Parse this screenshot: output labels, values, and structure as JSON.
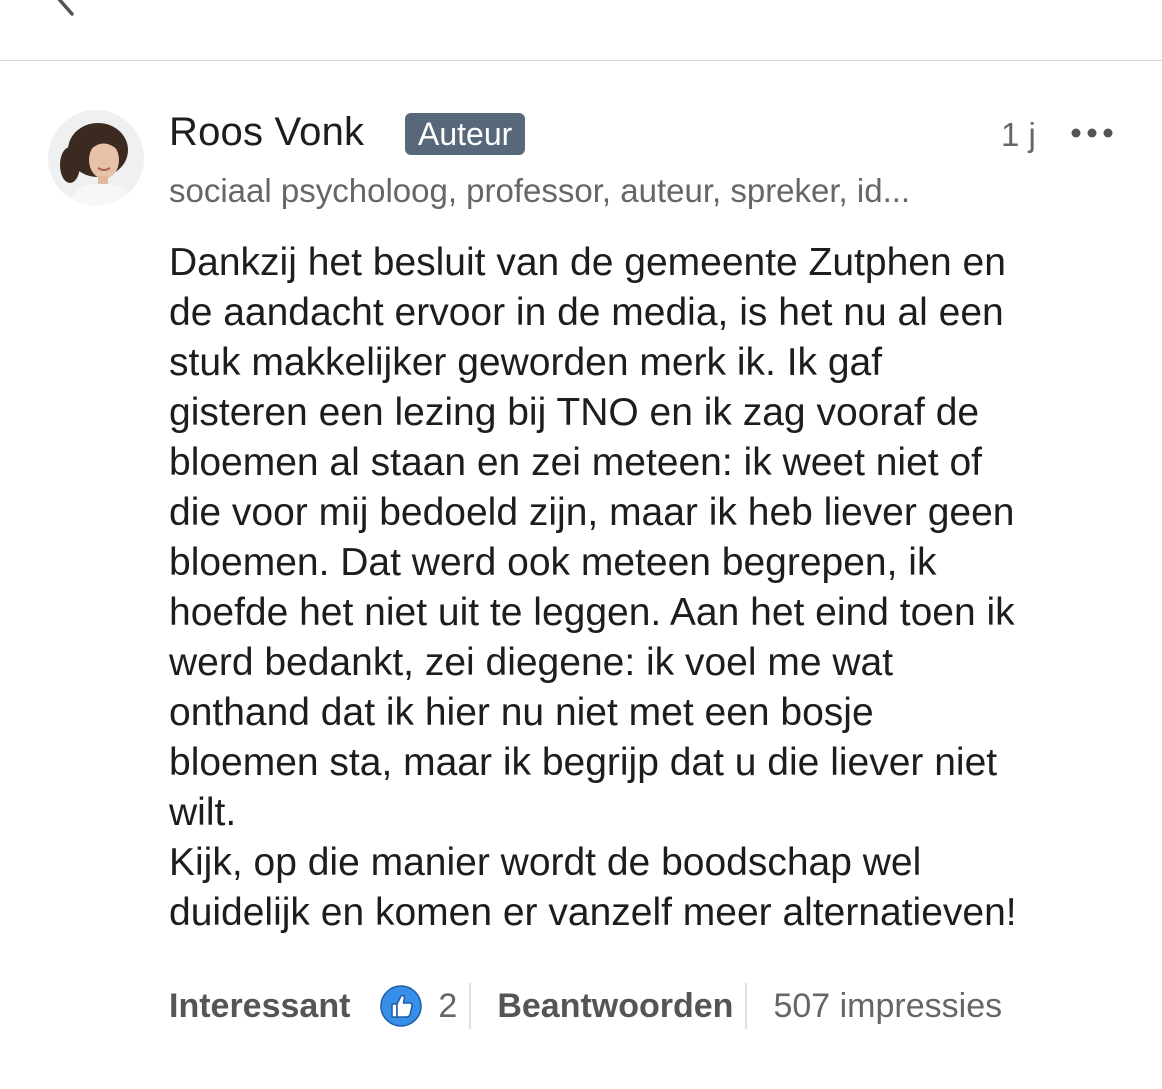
{
  "comment": {
    "author_name": "Roos Vonk",
    "author_badge": "Auteur",
    "timestamp": "1 j",
    "author_headline": "sociaal psycholoog, professor, auteur, spreker, id...",
    "body_lines": [
      "Dankzij het besluit van de gemeente Zutphen en",
      "de aandacht ervoor in de media, is het nu al een",
      "stuk makkelijker geworden merk ik. Ik gaf",
      "gisteren een lezing bij TNO en ik zag vooraf de",
      "bloemen al staan en zei meteen: ik weet niet of",
      "die voor mij bedoeld zijn, maar ik heb liever geen",
      "bloemen. Dat werd ook meteen begrepen, ik",
      "hoefde het niet uit te leggen. Aan het eind toen ik",
      "werd bedankt, zei diegene: ik voel me wat",
      "onthand dat ik hier nu niet met een bosje",
      "bloemen sta, maar ik begrijp dat u die liever niet",
      "wilt.",
      "Kijk, op die manier wordt de boodschap wel",
      "duidelijk en komen er vanzelf meer alternatieven!"
    ]
  },
  "actions": {
    "like_label": "Interessant",
    "reaction_icon": "thumbs-up-icon",
    "reaction_count": "2",
    "reply_label": "Beantwoorden",
    "impressions": "507 impressies"
  },
  "icons": {
    "back": "chevron-left-icon",
    "more": "more-dots-icon"
  },
  "colors": {
    "badge_bg": "#56687a",
    "like_blue": "#378fe9",
    "secondary_text": "#666666"
  }
}
